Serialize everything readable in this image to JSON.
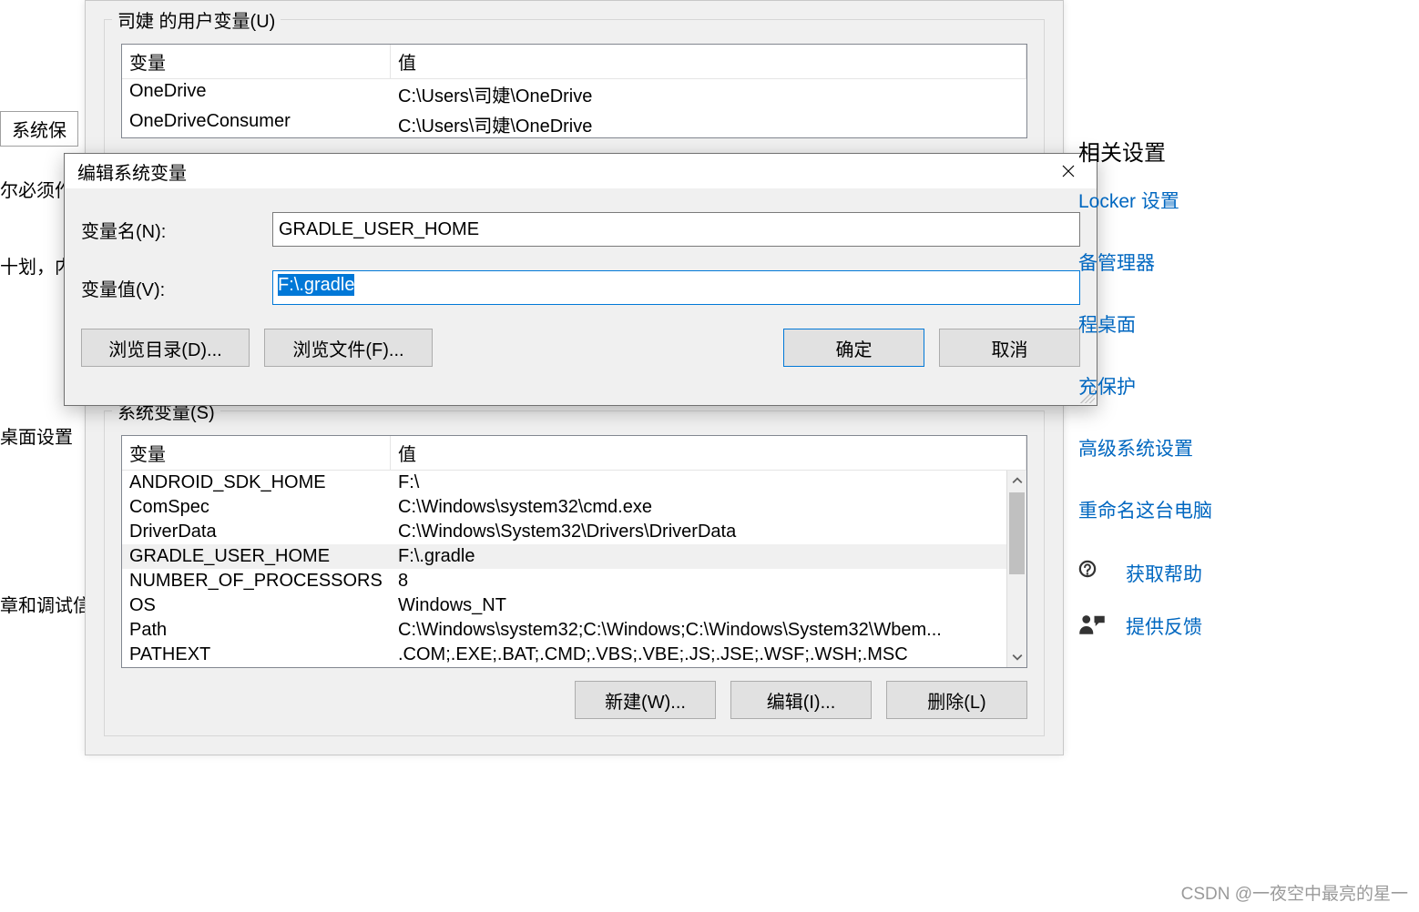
{
  "left_fragments": {
    "tab": "系统保",
    "l1": "尔必须作",
    "l2": "十划，内",
    "l3": "桌面设置",
    "l4": "章和调试信"
  },
  "env_dialog": {
    "user_group_title": "司婕 的用户变量(U)",
    "sys_group_title": "系统变量(S)",
    "col_var": "变量",
    "col_val": "值",
    "user_vars": [
      {
        "name": "OneDrive",
        "value": "C:\\Users\\司婕\\OneDrive"
      },
      {
        "name": "OneDriveConsumer",
        "value": "C:\\Users\\司婕\\OneDrive"
      }
    ],
    "sys_vars": [
      {
        "name": "ANDROID_SDK_HOME",
        "value": "F:\\"
      },
      {
        "name": "ComSpec",
        "value": "C:\\Windows\\system32\\cmd.exe"
      },
      {
        "name": "DriverData",
        "value": "C:\\Windows\\System32\\Drivers\\DriverData"
      },
      {
        "name": "GRADLE_USER_HOME",
        "value": "F:\\.gradle"
      },
      {
        "name": "NUMBER_OF_PROCESSORS",
        "value": "8"
      },
      {
        "name": "OS",
        "value": "Windows_NT"
      },
      {
        "name": "Path",
        "value": "C:\\Windows\\system32;C:\\Windows;C:\\Windows\\System32\\Wbem..."
      },
      {
        "name": "PATHEXT",
        "value": ".COM;.EXE;.BAT;.CMD;.VBS;.VBE;.JS;.JSE;.WSF;.WSH;.MSC"
      }
    ],
    "sys_selected_index": 3,
    "btn_new": "新建(W)...",
    "btn_edit": "编辑(I)...",
    "btn_delete": "删除(L)"
  },
  "edit_dialog": {
    "title": "编辑系统变量",
    "label_name": "变量名(N):",
    "label_value": "变量值(V):",
    "name_value": "GRADLE_USER_HOME",
    "value_value": "F:\\.gradle",
    "btn_browse_dir": "浏览目录(D)...",
    "btn_browse_file": "浏览文件(F)...",
    "btn_ok": "确定",
    "btn_cancel": "取消"
  },
  "sidebar": {
    "heading": "相关设置",
    "links": [
      "Locker 设置",
      "备管理器",
      "程桌面",
      "充保护",
      "高级系统设置",
      "重命名这台电脑"
    ],
    "help": "获取帮助",
    "feedback": "提供反馈"
  },
  "watermark": "CSDN @一夜空中最亮的星一"
}
